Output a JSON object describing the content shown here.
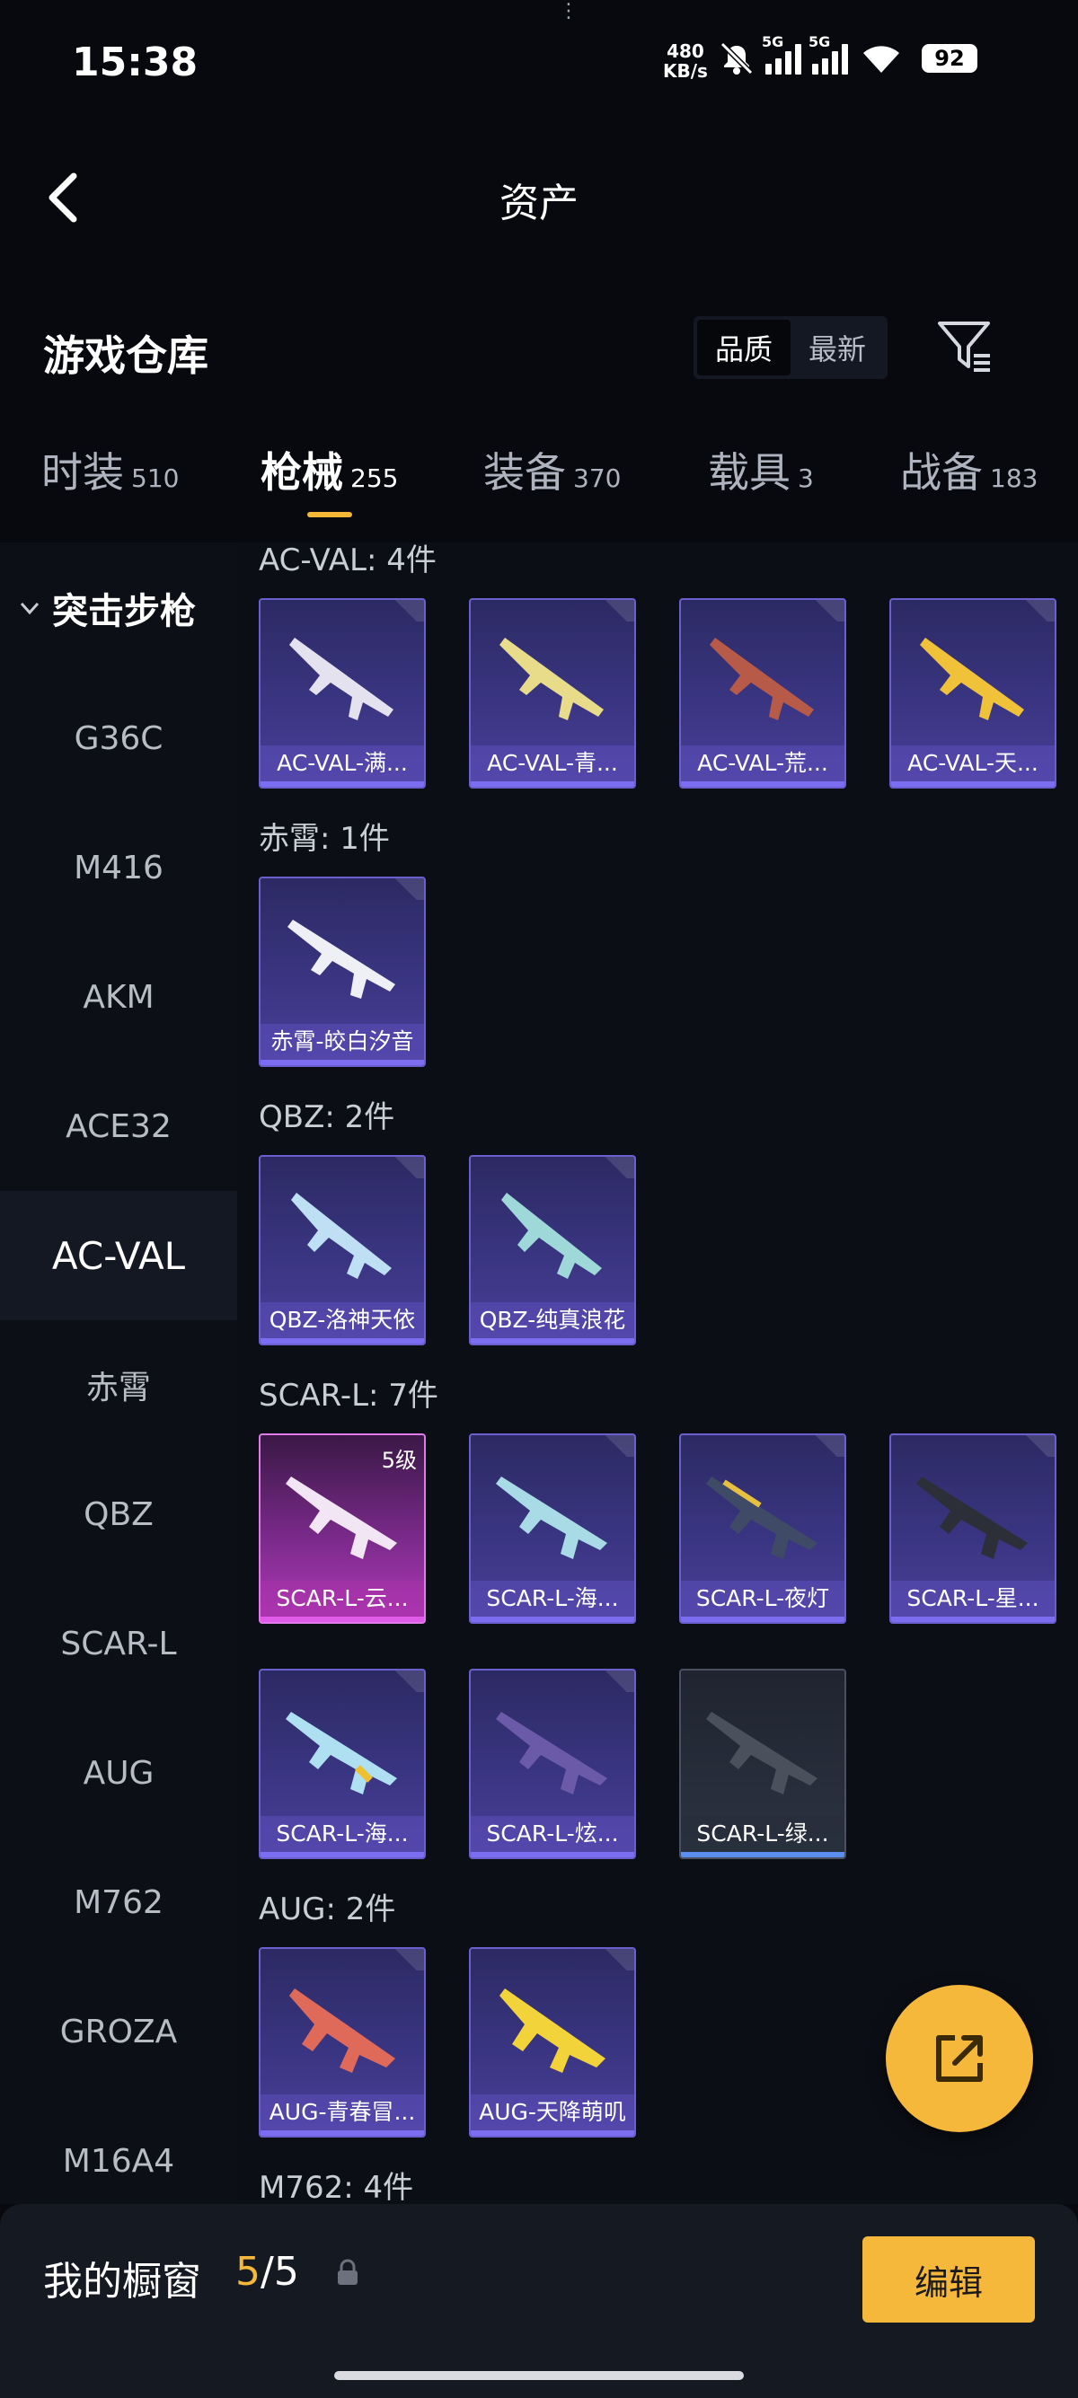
{
  "status_bar": {
    "time": "15:38",
    "net_speed_value": "480",
    "net_speed_unit": "KB/s",
    "signal1_tag": "5G",
    "signal2_tag": "5G",
    "battery": "92"
  },
  "header": {
    "title": "资产"
  },
  "section": {
    "title": "游戏仓库",
    "sort_options": [
      "品质",
      "最新"
    ],
    "sort_selected": "品质"
  },
  "category_tabs": [
    {
      "label": "时装",
      "count": "510"
    },
    {
      "label": "枪械",
      "count": "255"
    },
    {
      "label": "装备",
      "count": "370"
    },
    {
      "label": "载具",
      "count": "3"
    },
    {
      "label": "战备",
      "count": "183"
    }
  ],
  "sidebar": {
    "header": "突击步枪",
    "items": [
      "G36C",
      "M416",
      "AKM",
      "ACE32",
      "AC-VAL",
      "赤霄",
      "QBZ",
      "SCAR-L",
      "AUG",
      "M762",
      "GROZA",
      "M16A4"
    ],
    "active": "AC-VAL"
  },
  "groups": [
    {
      "label": "AC-VAL: 4件",
      "items": [
        "AC-VAL-满...",
        "AC-VAL-青...",
        "AC-VAL-荒...",
        "AC-VAL-天..."
      ]
    },
    {
      "label": "赤霄: 1件",
      "items": [
        "赤霄-皎白汐音"
      ]
    },
    {
      "label": "QBZ: 2件",
      "items": [
        "QBZ-洛神天依",
        "QBZ-纯真浪花"
      ]
    },
    {
      "label": "SCAR-L: 7件",
      "items": [
        "SCAR-L-云...",
        "SCAR-L-海...",
        "SCAR-L-夜灯",
        "SCAR-L-星...",
        "SCAR-L-海...",
        "SCAR-L-炫...",
        "SCAR-L-绿..."
      ]
    },
    {
      "label": "AUG: 2件",
      "items": [
        "AUG-青春冒...",
        "AUG-天降萌叽"
      ]
    },
    {
      "label": "M762: 4件",
      "items": []
    }
  ],
  "card_level_badge": "5级",
  "icons": {
    "back": "chevron-left-icon",
    "filter": "filter-icon",
    "share": "share-external-icon",
    "lock": "lock-icon"
  },
  "colors": {
    "accent": "#f5b83a",
    "card_purple": "#3a3582",
    "card_pink": "#b23ab8"
  },
  "bottom_bar": {
    "label": "我的橱窗",
    "current": "5",
    "separator": "/",
    "total": "5",
    "edit_label": "编辑"
  }
}
